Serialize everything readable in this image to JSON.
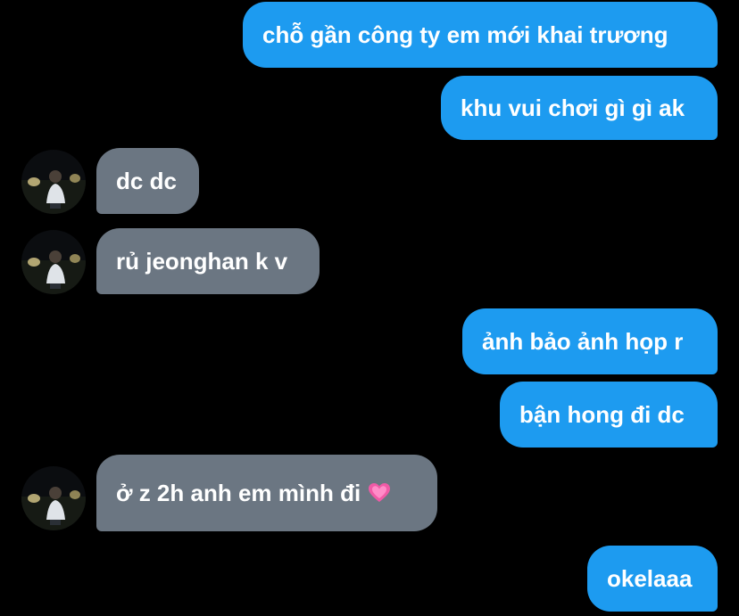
{
  "messages": [
    {
      "side": "sent",
      "text": "chỗ gần công ty em mới khai trương"
    },
    {
      "side": "sent",
      "text": "khu vui chơi gì gì ak"
    },
    {
      "side": "received",
      "text": "dc dc"
    },
    {
      "side": "received",
      "text": "rủ jeonghan k v"
    },
    {
      "side": "sent",
      "text": "ảnh bảo ảnh họp r"
    },
    {
      "side": "sent",
      "text": "bận hong đi dc"
    },
    {
      "side": "received",
      "text": "ở z 2h anh em mình đi",
      "emoji": "pink-heart"
    },
    {
      "side": "sent",
      "text": "okelaaa"
    }
  ],
  "colors": {
    "background": "#000000",
    "sent_bubble": "#1d9bf0",
    "received_bubble": "#6b7682",
    "text": "#ffffff"
  },
  "icons": {
    "avatar": "user-avatar-photo",
    "emoji": "pink-heart-icon"
  }
}
